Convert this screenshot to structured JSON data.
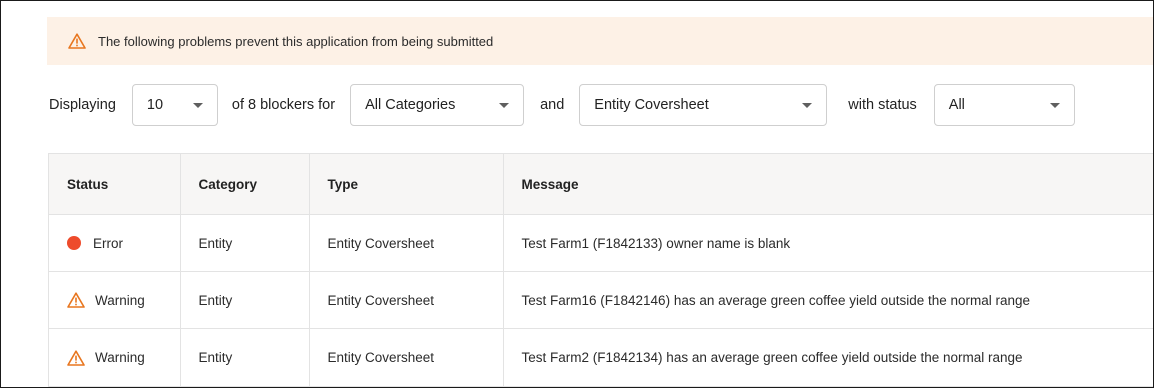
{
  "banner": {
    "icon": "warning-triangle-icon",
    "text": "The following problems prevent this application from being submitted",
    "background": "#fdf1e6",
    "accent": "#e8761f"
  },
  "filters": {
    "displaying_label": "Displaying",
    "page_size": "10",
    "of_label": "of 8 blockers for",
    "category": "All Categories",
    "and_label": "and",
    "type": "Entity Coversheet",
    "with_status_label": "with status",
    "status": "All"
  },
  "table": {
    "columns": [
      "Status",
      "Category",
      "Type",
      "Message"
    ],
    "rows": [
      {
        "status": "Error",
        "status_icon": "error-dot-icon",
        "status_color": "#ee4b2b",
        "category": "Entity",
        "type": "Entity Coversheet",
        "message": "Test Farm1 (F1842133) owner name is blank"
      },
      {
        "status": "Warning",
        "status_icon": "warning-triangle-icon",
        "status_color": "#e8761f",
        "category": "Entity",
        "type": "Entity Coversheet",
        "message": "Test Farm16 (F1842146) has an average green coffee yield outside the normal range"
      },
      {
        "status": "Warning",
        "status_icon": "warning-triangle-icon",
        "status_color": "#e8761f",
        "category": "Entity",
        "type": "Entity Coversheet",
        "message": "Test Farm2 (F1842134) has an average green coffee yield outside the normal range"
      }
    ]
  }
}
